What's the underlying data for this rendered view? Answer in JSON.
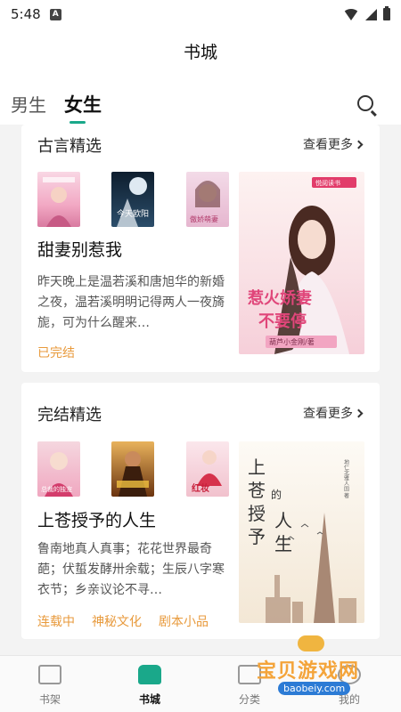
{
  "status": {
    "time": "5:48",
    "notif": "A"
  },
  "header": {
    "title": "书城"
  },
  "tabs": {
    "male": "男生",
    "female": "女生"
  },
  "sections": [
    {
      "title": "古言精选",
      "more": "查看更多",
      "thumb_titles": [
        "",
        "今天欧阳",
        "傲娇萌妻"
      ],
      "book_title": "甜妻别惹我",
      "desc": "昨天晚上是温若溪和唐旭华的新婚之夜，温若溪明明记得两人一夜旖旎，可为什么醒来…",
      "tags": [
        "已完结"
      ],
      "cover": {
        "title": "惹火娇妻不要停",
        "author": "葫芦小金刚/著",
        "badge": "悦阅读书"
      }
    },
    {
      "title": "完结精选",
      "more": "查看更多",
      "thumb_titles": [
        "总裁的独宠",
        "",
        "红妆"
      ],
      "book_title": "上苍授予的人生",
      "desc": "鲁南地真人真事；花花世界最奇葩；伏蜇发酵卅余载；生辰八字寒衣节；乡亲议论不寻…",
      "tags": [
        "连载中",
        "神秘文化",
        "剧本小品"
      ],
      "cover": {
        "title": "上苍授予的人生",
        "author": "地仁北雅人国 著"
      }
    }
  ],
  "bottom_nav": [
    "书架",
    "书城",
    "分类",
    "我的"
  ],
  "watermark": {
    "text": "宝贝游戏网",
    "url": "baobeiy.com"
  },
  "colors": {
    "accent": "#1aa88a",
    "tag": "#e89a3c"
  }
}
